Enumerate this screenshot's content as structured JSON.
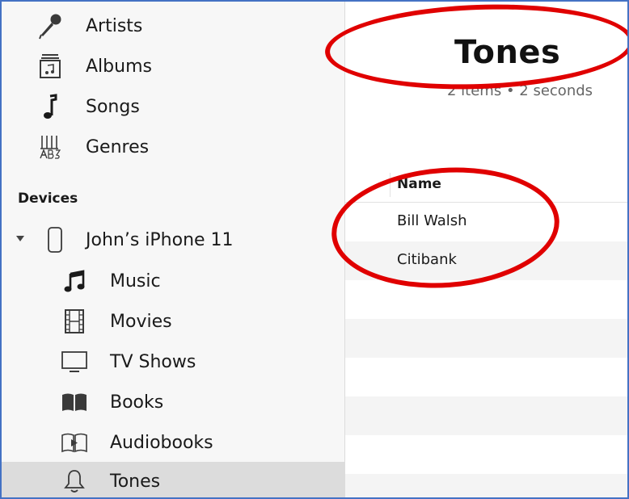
{
  "sidebar": {
    "library_items": [
      {
        "label": "Artists",
        "icon": "microphone-icon"
      },
      {
        "label": "Albums",
        "icon": "album-icon"
      },
      {
        "label": "Songs",
        "icon": "music-note-icon"
      },
      {
        "label": "Genres",
        "icon": "genres-icon"
      }
    ],
    "devices_heading": "Devices",
    "device": {
      "label": "John’s iPhone 11",
      "icon": "iphone-icon"
    },
    "device_items": [
      {
        "label": "Music",
        "icon": "music-icon"
      },
      {
        "label": "Movies",
        "icon": "film-icon"
      },
      {
        "label": "TV Shows",
        "icon": "tv-icon"
      },
      {
        "label": "Books",
        "icon": "book-icon"
      },
      {
        "label": "Audiobooks",
        "icon": "audiobook-icon"
      },
      {
        "label": "Tones",
        "icon": "bell-icon",
        "selected": true
      }
    ]
  },
  "main": {
    "title": "Tones",
    "subtitle": "2 items • 2 seconds",
    "columns": [
      "Name"
    ],
    "rows": [
      {
        "name": "Bill Walsh"
      },
      {
        "name": "Citibank"
      }
    ]
  },
  "colors": {
    "annotation": "#e00000",
    "frame_border": "#4472c4",
    "selected_bg": "#dcdcdc"
  }
}
